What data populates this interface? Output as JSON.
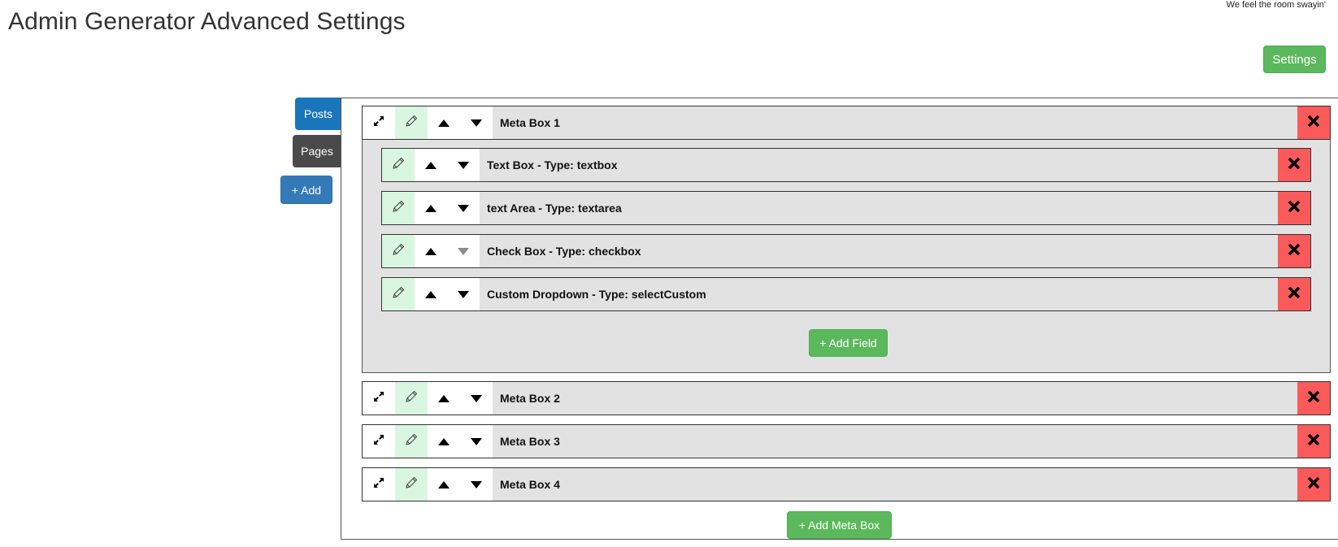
{
  "header": {
    "title": "Admin Generator Advanced Settings",
    "tagline": "We feel the room swayin'",
    "settings_label": "Settings"
  },
  "tabs": [
    {
      "label": "Posts",
      "active": true
    },
    {
      "label": "Pages",
      "active": false
    }
  ],
  "add_tab_label": "+ Add",
  "metaboxes": [
    {
      "label": "Meta Box 1",
      "expanded": true
    },
    {
      "label": "Meta Box 2",
      "expanded": false
    },
    {
      "label": "Meta Box 3",
      "expanded": false
    },
    {
      "label": "Meta Box 4",
      "expanded": false
    }
  ],
  "fields": [
    {
      "label": "Text Box - Type: textbox",
      "down_disabled": false
    },
    {
      "label": "text Area - Type: textarea",
      "down_disabled": false
    },
    {
      "label": "Check Box - Type: checkbox",
      "down_disabled": true
    },
    {
      "label": "Custom Dropdown - Type: selectCustom",
      "down_disabled": false
    }
  ],
  "add_field_label": "+ Add Field",
  "add_metabox_label": "+ Add Meta Box",
  "icons": {
    "expand": "expand-arrows-icon",
    "edit": "pencil-icon",
    "up": "triangle-up-icon",
    "down": "triangle-down-icon",
    "delete": "close-x-icon"
  },
  "colors": {
    "success": "#5cb85c",
    "primary": "#337ab7",
    "tab_active": "#1b75bb",
    "tab_inactive": "#4a4a4a",
    "danger": "#fa5a5a",
    "edit_cell": "#d9f7e0",
    "row_bg": "#e2e2e2"
  }
}
